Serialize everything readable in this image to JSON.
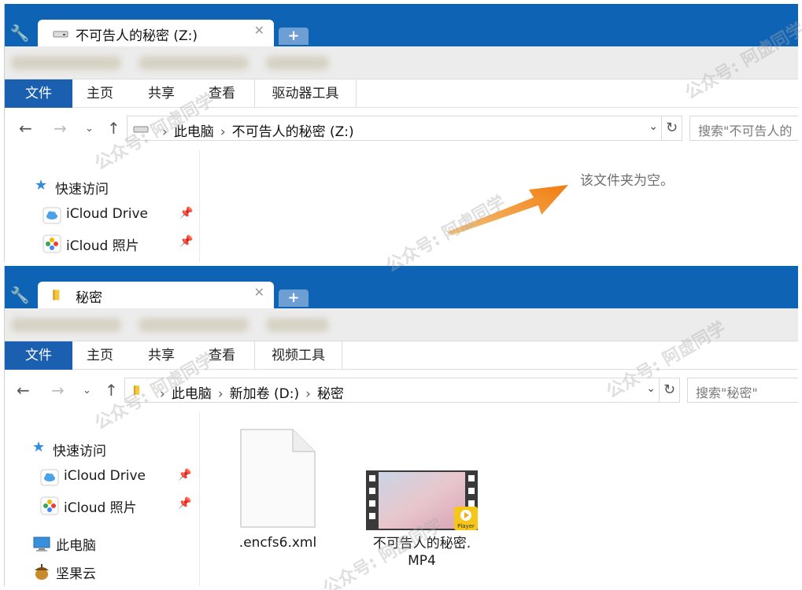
{
  "top_window": {
    "tab_title": "不可告人的秘密 (Z:)",
    "ribbon_tabs": [
      "文件",
      "主页",
      "共享",
      "查看",
      "驱动器工具"
    ],
    "breadcrumb": [
      "此电脑",
      "不可告人的秘密 (Z:)"
    ],
    "search_placeholder": "搜索\"不可告人的",
    "sidebar": {
      "quick_access": "快速访问",
      "items": [
        "iCloud Drive",
        "iCloud 照片"
      ]
    },
    "empty_message": "该文件夹为空。"
  },
  "bottom_window": {
    "tab_title": "秘密",
    "ribbon_tabs": [
      "文件",
      "主页",
      "共享",
      "查看",
      "视频工具"
    ],
    "breadcrumb": [
      "此电脑",
      "新加卷 (D:)",
      "秘密"
    ],
    "search_placeholder": "搜索\"秘密\"",
    "sidebar": {
      "quick_access": "快速访问",
      "items": [
        "iCloud Drive",
        "iCloud 照片",
        "此电脑",
        "坚果云"
      ]
    },
    "files": [
      {
        "name": ".encfs6.xml",
        "type": "document"
      },
      {
        "name": "不可告人的秘密.\nMP4",
        "type": "video",
        "badge": "Player"
      }
    ]
  },
  "watermark": "公众号: 阿虚同学",
  "colors": {
    "titlebar": "#0f63b5",
    "file_tab": "#1a5fb0",
    "arrow": "#f28a1c"
  }
}
